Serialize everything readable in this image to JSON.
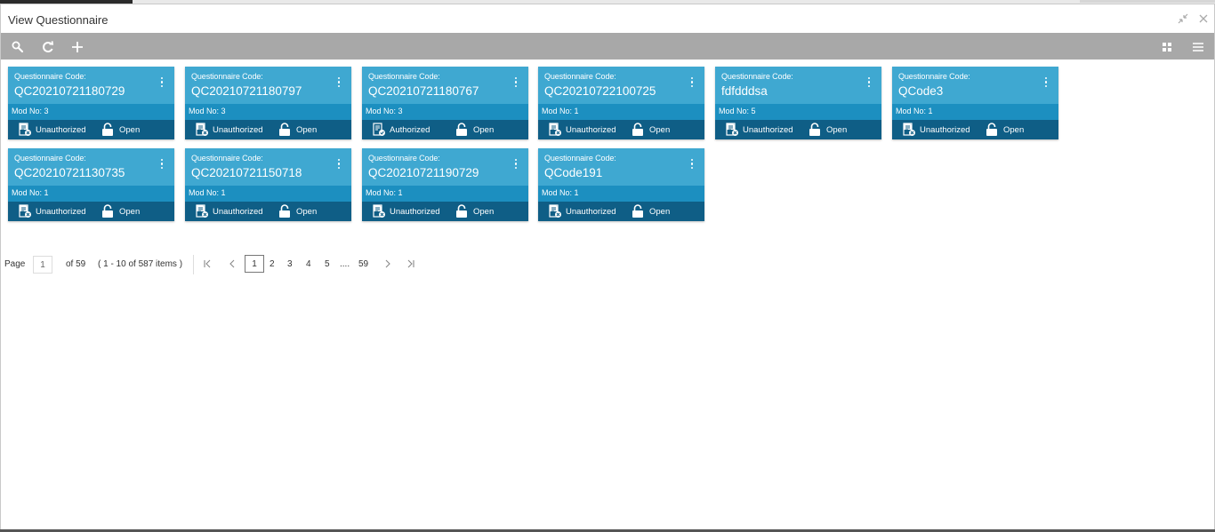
{
  "window": {
    "title": "View Questionnaire"
  },
  "toolbar": {
    "left_icons": [
      "search-icon",
      "refresh-icon",
      "add-icon"
    ],
    "right_icons": [
      "tile-view-icon",
      "list-view-icon"
    ]
  },
  "cards": [
    {
      "label": "Questionnaire Code:",
      "code": "QC20210721180729",
      "mod": "Mod No:  3",
      "status": "Unauthorized",
      "status_icon": "unauthorized-icon",
      "lock": "Open"
    },
    {
      "label": "Questionnaire Code:",
      "code": "QC20210721180797",
      "mod": "Mod No:  3",
      "status": "Unauthorized",
      "status_icon": "unauthorized-icon",
      "lock": "Open"
    },
    {
      "label": "Questionnaire Code:",
      "code": "QC20210721180767",
      "mod": "Mod No:  3",
      "status": "Authorized",
      "status_icon": "authorized-icon",
      "lock": "Open"
    },
    {
      "label": "Questionnaire Code:",
      "code": "QC20210722100725",
      "mod": "Mod No:  1",
      "status": "Unauthorized",
      "status_icon": "unauthorized-icon",
      "lock": "Open"
    },
    {
      "label": "Questionnaire Code:",
      "code": "fdfdddsa",
      "mod": "Mod No:  5",
      "status": "Unauthorized",
      "status_icon": "unauthorized-icon",
      "lock": "Open"
    },
    {
      "label": "Questionnaire Code:",
      "code": "QCode3",
      "mod": "Mod No:  1",
      "status": "Unauthorized",
      "status_icon": "unauthorized-icon",
      "lock": "Open"
    },
    {
      "label": "Questionnaire Code:",
      "code": "QC20210721130735",
      "mod": "Mod No:  1",
      "status": "Unauthorized",
      "status_icon": "unauthorized-icon",
      "lock": "Open"
    },
    {
      "label": "Questionnaire Code:",
      "code": "QC20210721150718",
      "mod": "Mod No:  1",
      "status": "Unauthorized",
      "status_icon": "unauthorized-icon",
      "lock": "Open"
    },
    {
      "label": "Questionnaire Code:",
      "code": "QC20210721190729",
      "mod": "Mod No:  1",
      "status": "Unauthorized",
      "status_icon": "unauthorized-icon",
      "lock": "Open"
    },
    {
      "label": "Questionnaire Code:",
      "code": "QCode191",
      "mod": "Mod No:  1",
      "status": "Unauthorized",
      "status_icon": "unauthorized-icon",
      "lock": "Open"
    }
  ],
  "pagination": {
    "page_label": "Page",
    "current_page": "1",
    "of_text": "of 59",
    "items_text": "( 1 - 10 of 587 items )",
    "pages": [
      "1",
      "2",
      "3",
      "4",
      "5",
      "....",
      "59"
    ]
  },
  "colors": {
    "card_header": "#3fa8d1",
    "card_mod_bar": "#1c8fc0",
    "card_footer": "#0f5e86",
    "toolbar": "#a8a8a8"
  }
}
